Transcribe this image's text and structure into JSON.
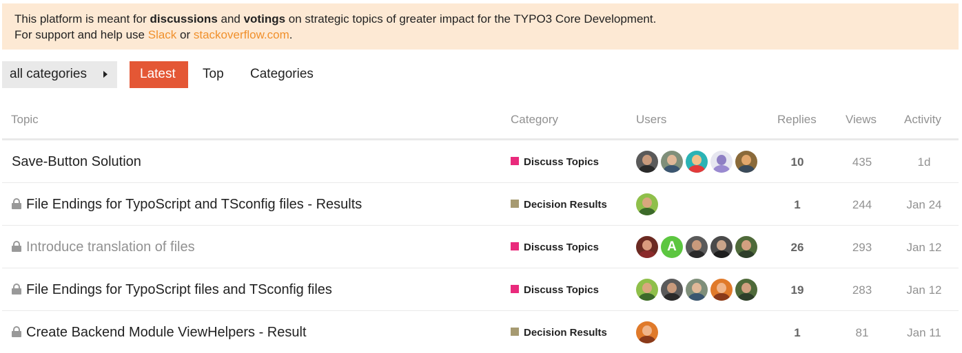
{
  "banner": {
    "text1": "This platform is meant for ",
    "bold1": "discussions",
    "text2": " and ",
    "bold2": "votings",
    "text3": " on strategic topics of greater impact for the TYPO3 Core Development.",
    "text4": "For support and help use ",
    "link1": "Slack",
    "text5": " or ",
    "link2": "stackoverflow.com",
    "text6": "."
  },
  "nav": {
    "category_dropdown": "all categories",
    "tabs": [
      "Latest",
      "Top",
      "Categories"
    ],
    "active_tab": "Latest"
  },
  "table": {
    "headers": {
      "topic": "Topic",
      "category": "Category",
      "users": "Users",
      "replies": "Replies",
      "views": "Views",
      "activity": "Activity"
    },
    "rows": [
      {
        "title": "Save-Button Solution",
        "locked": false,
        "visited": false,
        "category": "Discuss Topics",
        "category_color": "#e92a7c",
        "replies": "10",
        "views": "435",
        "activity": "1d"
      },
      {
        "title": "File Endings for TypoScript and TSconfig files - Results",
        "locked": true,
        "visited": false,
        "category": "Decision Results",
        "category_color": "#a69a71",
        "replies": "1",
        "views": "244",
        "activity": "Jan 24"
      },
      {
        "title": "Introduce translation of files",
        "locked": true,
        "visited": true,
        "category": "Discuss Topics",
        "category_color": "#e92a7c",
        "replies": "26",
        "views": "293",
        "activity": "Jan 12"
      },
      {
        "title": "File Endings for TypoScript files and TSconfig files",
        "locked": true,
        "visited": false,
        "category": "Discuss Topics",
        "category_color": "#e92a7c",
        "replies": "19",
        "views": "283",
        "activity": "Jan 12"
      },
      {
        "title": "Create Backend Module ViewHelpers - Result",
        "locked": true,
        "visited": false,
        "category": "Decision Results",
        "category_color": "#a69a71",
        "replies": "1",
        "views": "81",
        "activity": "Jan 11"
      }
    ],
    "avatar_letter": "A"
  },
  "colors": {
    "accent": "#e45735",
    "link": "#f0902c",
    "banner_bg": "#fde9d4",
    "discuss_topics": "#e92a7c",
    "decision_results": "#a69a71"
  }
}
